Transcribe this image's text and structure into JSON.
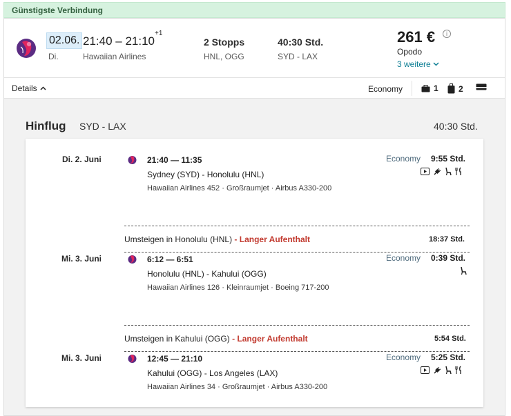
{
  "banner": {
    "label": "Günstigste Verbindung"
  },
  "summary": {
    "date": "02.06.",
    "weekday": "Di.",
    "times": "21:40 – 21:10",
    "day_offset": "+1",
    "airline": "Hawaiian Airlines",
    "stops": "2 Stopps",
    "stop_codes": "HNL, OGG",
    "duration": "40:30 Std.",
    "route": "SYD - LAX",
    "price": "261 €",
    "provider": "Opodo",
    "more_label": "3 weitere"
  },
  "toolbar": {
    "details_label": "Details",
    "cabin_class": "Economy",
    "personal_bag_count": "1",
    "carry_on_count": "2"
  },
  "section": {
    "title": "Hinflug",
    "route": "SYD - LAX",
    "duration": "40:30 Std."
  },
  "legs": [
    {
      "date": "Di. 2. Juni",
      "times": "21:40 — 11:35",
      "route": "Sydney (SYD) - Honolulu (HNL)",
      "info": "Hawaiian Airlines 452 · Großraumjet · Airbus A330-200",
      "cabin": "Economy",
      "duration": "9:55 Std.",
      "amenities": [
        "video-icon",
        "power-icon",
        "seat-icon",
        "meal-icon"
      ]
    },
    {
      "date": "Mi. 3. Juni",
      "times": "6:12 — 6:51",
      "route": "Honolulu (HNL) - Kahului (OGG)",
      "info": "Hawaiian Airlines 126 · Kleinraumjet · Boeing 717-200",
      "cabin": "Economy",
      "duration": "0:39 Std.",
      "amenities": [
        "seat-icon"
      ]
    },
    {
      "date": "Mi. 3. Juni",
      "times": "12:45 — 21:10",
      "route": "Kahului (OGG) - Los Angeles (LAX)",
      "info": "Hawaiian Airlines 34 · Großraumjet · Airbus A330-200",
      "cabin": "Economy",
      "duration": "5:25 Std.",
      "amenities": [
        "video-icon",
        "power-icon",
        "seat-icon",
        "meal-icon"
      ]
    }
  ],
  "transfers": [
    {
      "label": "Umsteigen in Honolulu (HNL)",
      "separator": "-",
      "warning": "Langer Aufenthalt",
      "duration": "18:37 Std."
    },
    {
      "label": "Umsteigen in Kahului (OGG)",
      "separator": "-",
      "warning": "Langer Aufenthalt",
      "duration": "5:54 Std."
    }
  ],
  "colors": {
    "banner_bg": "#d6f2df",
    "accent_link": "#0d7e94",
    "warning": "#c23a2f",
    "airline_purple": "#5b2c83",
    "airline_red": "#e0245e"
  }
}
